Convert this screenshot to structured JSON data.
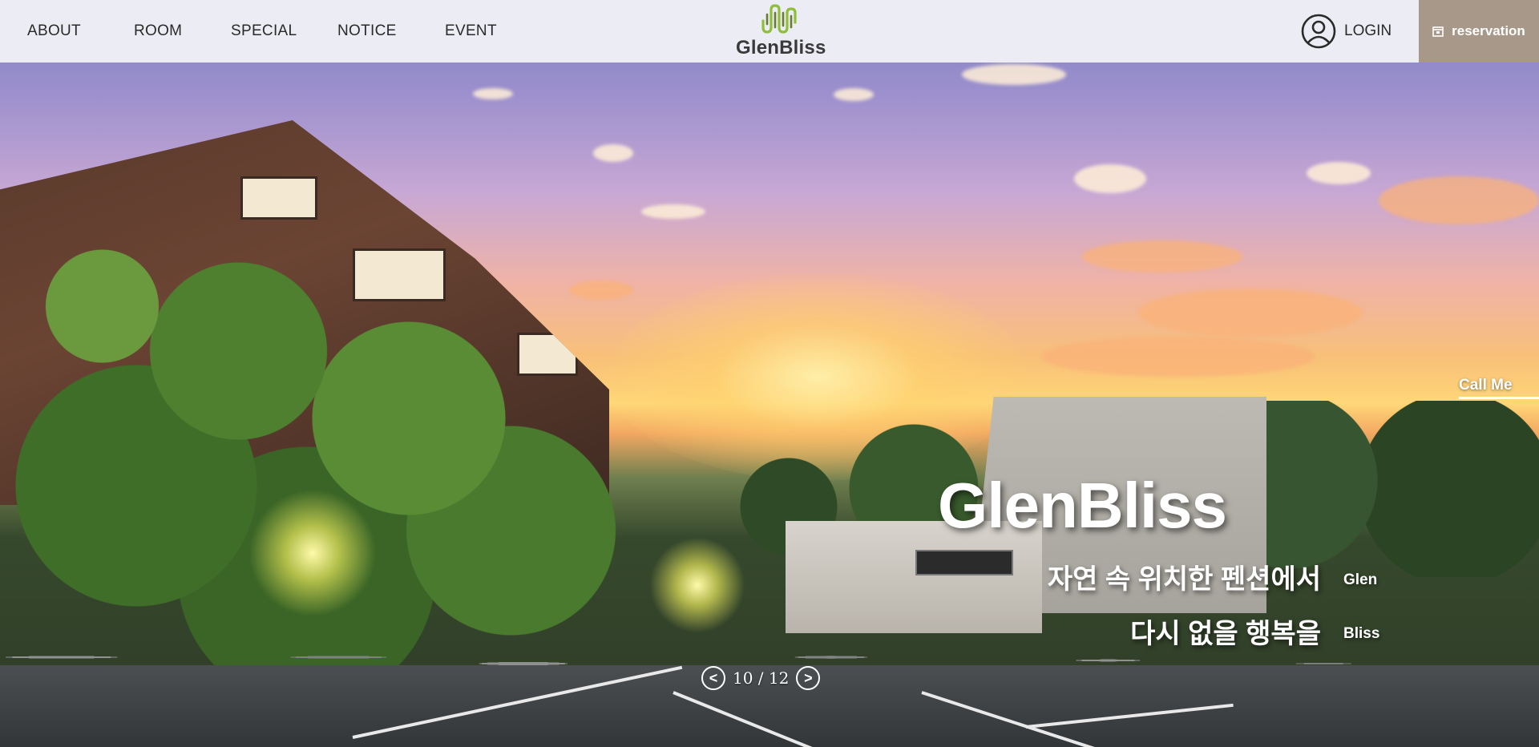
{
  "nav": {
    "items": [
      {
        "label": "ABOUT"
      },
      {
        "label": "ROOM"
      },
      {
        "label": "SPECIAL"
      },
      {
        "label": "NOTICE"
      },
      {
        "label": "EVENT"
      }
    ]
  },
  "logo": {
    "text": "GlenBliss",
    "icon": "wave-logo-icon"
  },
  "header": {
    "login_label": "LOGIN",
    "reservation_label": "reservation"
  },
  "hero": {
    "call_label": "Call Me",
    "title": "GlenBliss",
    "line1": "자연 속 위치한 펜션에서",
    "line2": "다시 없을 행복을",
    "side1": "Glen",
    "side2": "Bliss"
  },
  "slider": {
    "counter": "10 / 12",
    "prev": "<",
    "next": ">"
  },
  "colors": {
    "reservation_bg": "#a89889",
    "header_bg": "#f2f2f6",
    "logo_green": "#8fbf3a",
    "logo_olive": "#6b7a35"
  }
}
